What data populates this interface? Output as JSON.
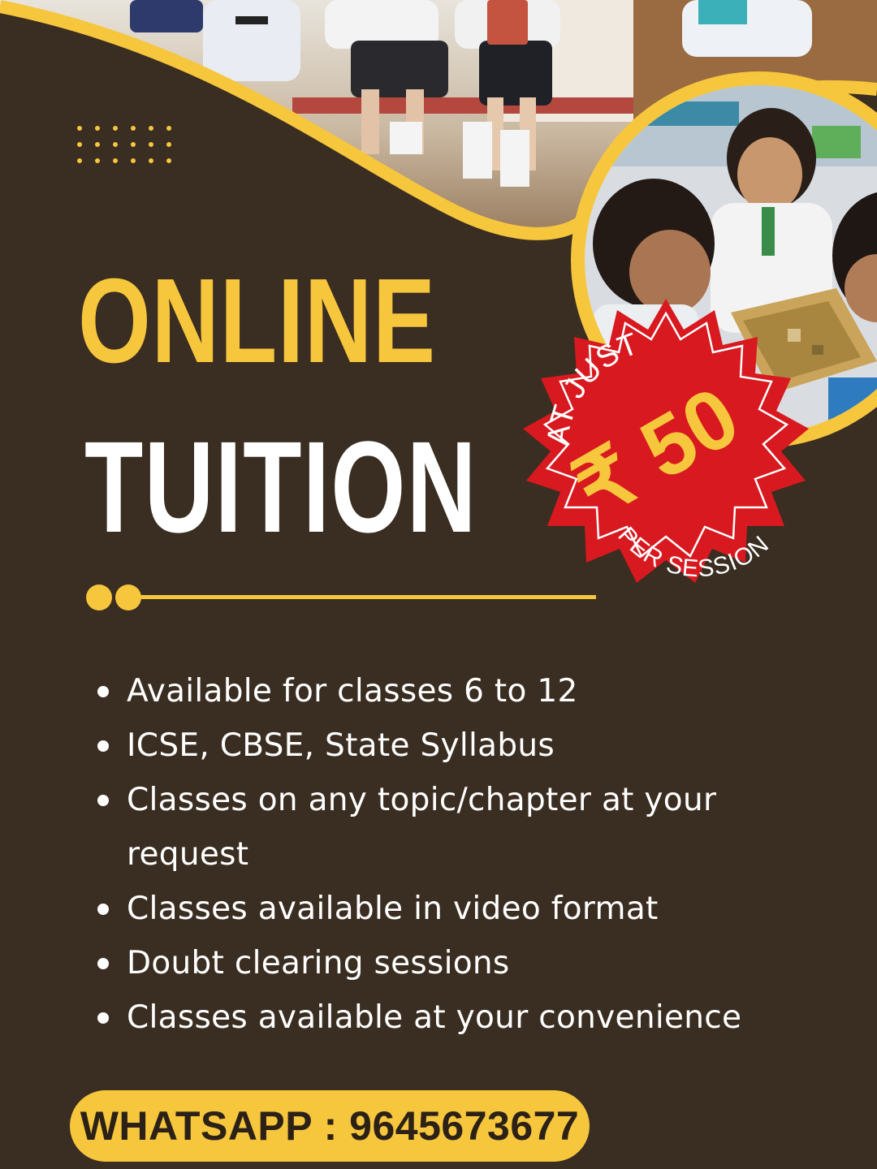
{
  "heading": {
    "line1": "ONLINE",
    "line2": "TUITION"
  },
  "badge": {
    "top_text": "AT JUST",
    "price": "₹ 50",
    "bottom_text": "PER SESSION"
  },
  "features": [
    "Available for classes 6 to 12",
    "ICSE, CBSE, State Syllabus",
    "Classes on any topic/chapter at your request",
    "Classes available in video format",
    "Doubt clearing sessions",
    "Classes available at your convenience"
  ],
  "contact": {
    "label": "WHATSAPP : 9645673677"
  },
  "colors": {
    "background": "#3a2d21",
    "accent_yellow": "#f6c63d",
    "badge_red": "#d8191f",
    "text_white": "#ffffff"
  },
  "images": {
    "top_photo": "students-running-photo",
    "circle_photo": "students-studying-photo"
  }
}
